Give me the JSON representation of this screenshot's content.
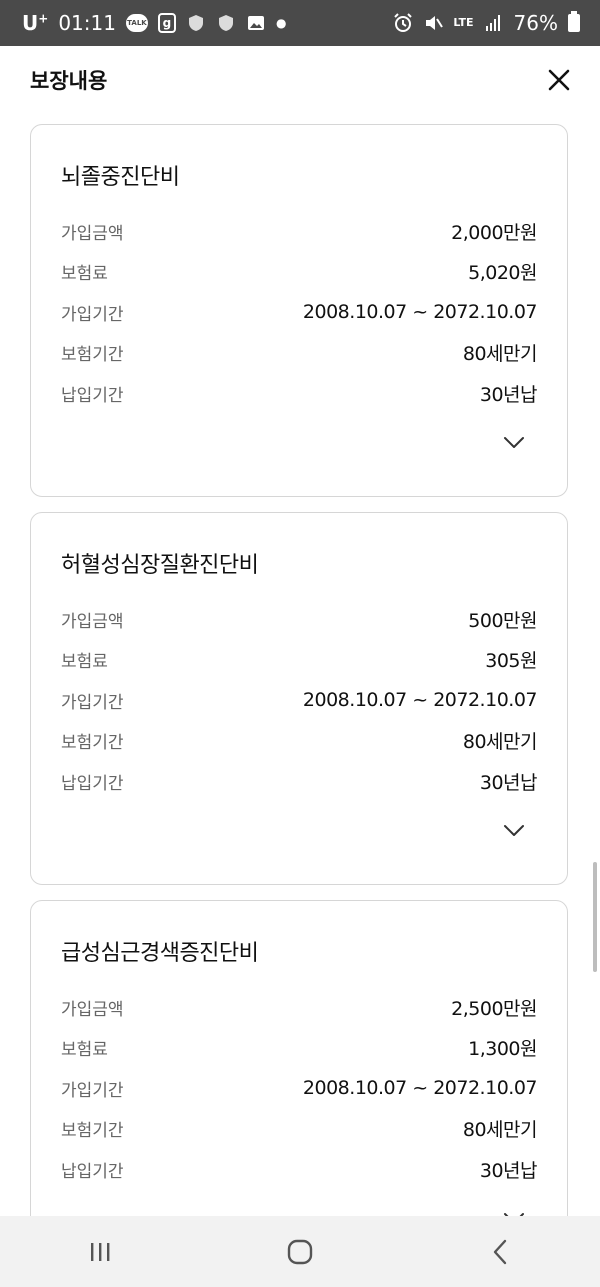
{
  "status_bar": {
    "carrier": "U",
    "carrier_sup": "+",
    "time": "01:11",
    "talk": "TALK",
    "g": "g",
    "lte": "LTE",
    "battery_percent": "76%"
  },
  "header": {
    "title": "보장내용"
  },
  "cards": [
    {
      "title": "뇌졸중진단비",
      "rows": [
        {
          "label": "가입금액",
          "value": "2,000만원"
        },
        {
          "label": "보험료",
          "value": "5,020원"
        },
        {
          "label": "가입기간",
          "value": "2008.10.07 ~ 2072.10.07"
        },
        {
          "label": "보험기간",
          "value": "80세만기"
        },
        {
          "label": "납입기간",
          "value": "30년납"
        }
      ]
    },
    {
      "title": "허혈성심장질환진단비",
      "rows": [
        {
          "label": "가입금액",
          "value": "500만원"
        },
        {
          "label": "보험료",
          "value": "305원"
        },
        {
          "label": "가입기간",
          "value": "2008.10.07 ~ 2072.10.07"
        },
        {
          "label": "보험기간",
          "value": "80세만기"
        },
        {
          "label": "납입기간",
          "value": "30년납"
        }
      ]
    },
    {
      "title": "급성심근경색증진단비",
      "rows": [
        {
          "label": "가입금액",
          "value": "2,500만원"
        },
        {
          "label": "보험료",
          "value": "1,300원"
        },
        {
          "label": "가입기간",
          "value": "2008.10.07 ~ 2072.10.07"
        },
        {
          "label": "보험기간",
          "value": "80세만기"
        },
        {
          "label": "납입기간",
          "value": "30년납"
        }
      ]
    }
  ],
  "colors": {
    "status_bar_bg": "#4a4a4a",
    "label": "#666666",
    "value": "#111111",
    "card_border": "#d6d6d6",
    "nav_bg": "#f2f2f2"
  }
}
